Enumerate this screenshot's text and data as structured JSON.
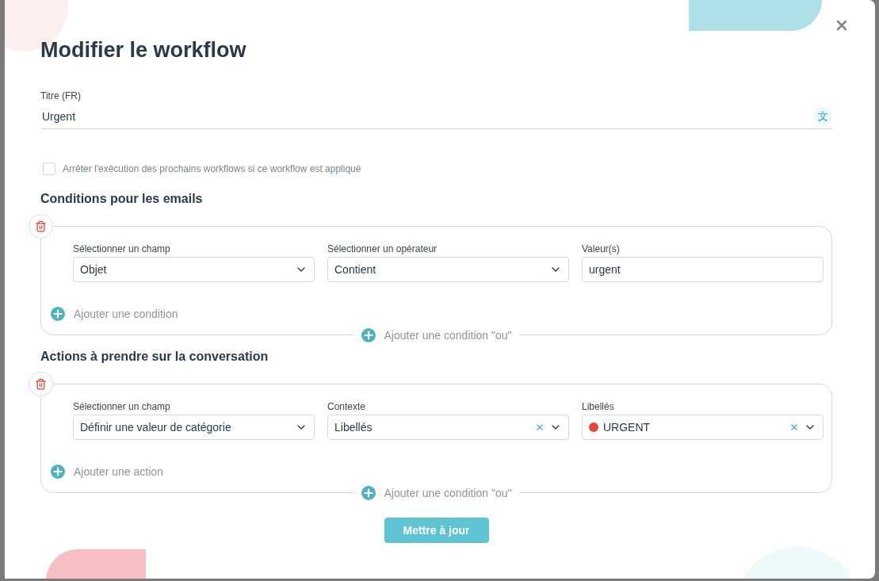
{
  "title": "Modifier le workflow",
  "title_field": {
    "label": "Titre (FR)",
    "value": "Urgent",
    "translate_glyph": "文"
  },
  "stop_option": {
    "label": "Arrêter l'exécution des prochains workflows si ce workflow est appliqué",
    "checked": false
  },
  "sections": [
    {
      "heading": "Conditions pour les emails",
      "fields": [
        {
          "kind": "select",
          "label": "Sélectionner un champ",
          "value": "Objet"
        },
        {
          "kind": "select",
          "label": "Sélectionner un opérateur",
          "value": "Contient"
        },
        {
          "kind": "input",
          "label": "Valeur(s)",
          "value": "urgent"
        }
      ],
      "add_label": "Ajouter une condition",
      "or_label": "Ajouter une condition \"ou\""
    },
    {
      "heading": "Actions à prendre sur la conversation",
      "fields": [
        {
          "kind": "select",
          "label": "Sélectionner un champ",
          "value": "Définir une valeur de catégorie"
        },
        {
          "kind": "clearable_select",
          "label": "Contexte",
          "value": "Libellés"
        },
        {
          "kind": "clearable_select",
          "label": "Libellés",
          "value": "URGENT",
          "color": "#e8453c"
        }
      ],
      "add_label": "Ajouter une action",
      "or_label": "Ajouter une condition \"ou\""
    }
  ],
  "submit": "Mettre à jour"
}
